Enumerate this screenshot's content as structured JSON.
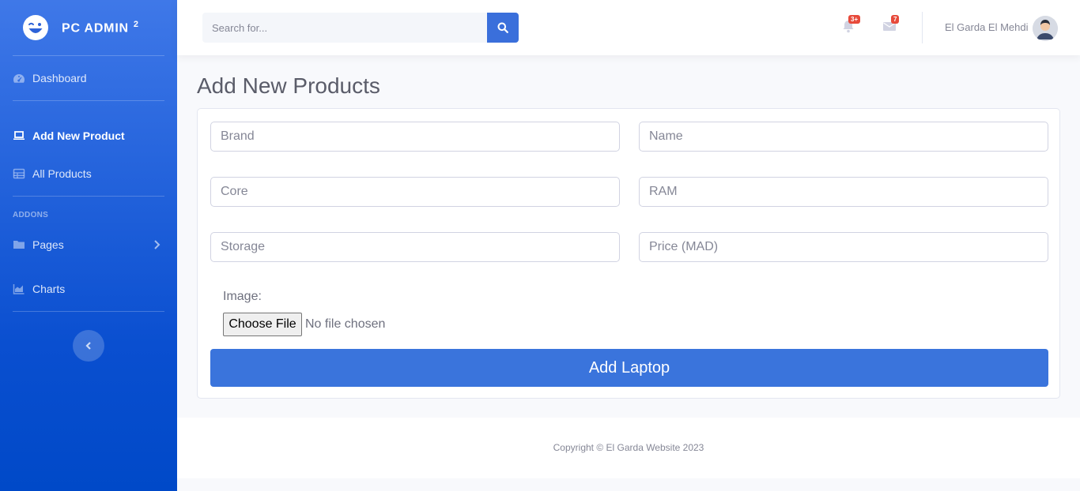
{
  "brand": {
    "name": "PC ADMIN",
    "sup": "2",
    "icon": "laugh-wink-icon"
  },
  "sidebar": {
    "items": [
      {
        "label": "Dashboard",
        "icon": "tachometer-icon"
      },
      {
        "label": "Add New Product",
        "icon": "laptop-icon",
        "active": true
      },
      {
        "label": "All Products",
        "icon": "table-icon"
      }
    ],
    "heading": "ADDONS",
    "addons": [
      {
        "label": "Pages",
        "icon": "folder-icon"
      },
      {
        "label": "Charts",
        "icon": "chart-area-icon"
      }
    ]
  },
  "topbar": {
    "search_placeholder": "Search for...",
    "alerts_badge": "3+",
    "messages_badge": "7",
    "user_name": "El Garda El Mehdi"
  },
  "main": {
    "title": "Add New Products",
    "form": {
      "brand_placeholder": "Brand",
      "name_placeholder": "Name",
      "core_placeholder": "Core",
      "ram_placeholder": "RAM",
      "storage_placeholder": "Storage",
      "price_placeholder": "Price (MAD)",
      "image_label": "Image:",
      "file_button": "Choose File",
      "file_status": "No file chosen",
      "submit_label": "Add Laptop"
    }
  },
  "footer": {
    "copyright": "Copyright © El Garda Website 2023"
  },
  "colors": {
    "primary": "#3a74dc",
    "sidebar": "#0a4fd0",
    "badge": "#e74a3b"
  }
}
